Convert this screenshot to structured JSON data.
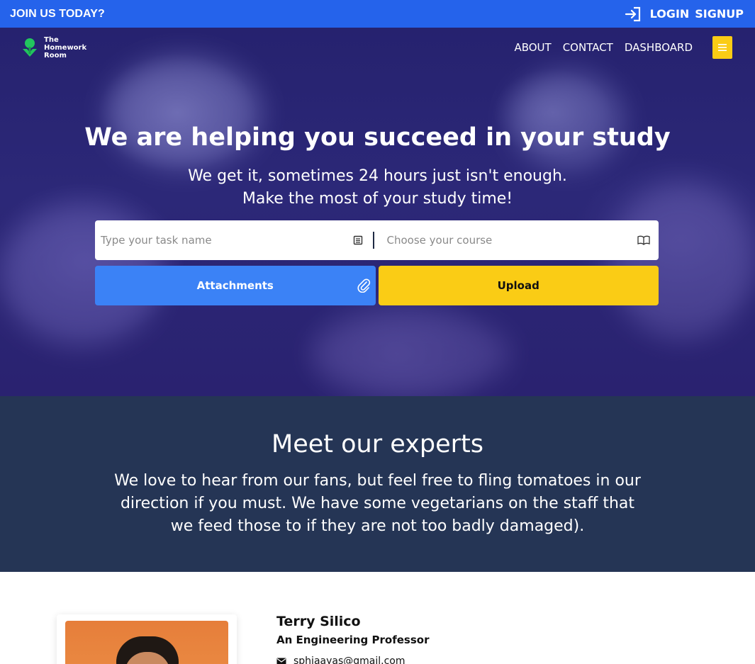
{
  "topbar": {
    "join_text": "JOIN US TODAY?",
    "login_label": "LOGIN",
    "signup_label": "SIGNUP",
    "background": "#2563eb"
  },
  "brand": {
    "logo_lines": [
      "The",
      "Homework",
      "Room"
    ],
    "logo_icon": "graduation-tree-icon",
    "logo_color": "#22c55e"
  },
  "nav": {
    "links": [
      "ABOUT",
      "CONTACT",
      "DASHBOARD"
    ],
    "menu_icon": "hamburger-icon",
    "menu_color": "#facc15"
  },
  "hero": {
    "title": "We are helping you succeed in your study",
    "subtitle_line1": "We get it, sometimes 24 hours just isn't enough.",
    "subtitle_line2": "Make the most of your study time!",
    "task_placeholder": "Type your task name",
    "course_placeholder": "Choose your course",
    "task_icon": "clipboard-icon",
    "course_icon": "book-icon",
    "attachments_label": "Attachments",
    "attachments_icon": "paperclip-icon",
    "upload_label": "Upload",
    "attachments_color": "#3b82f6",
    "upload_color": "#facc15"
  },
  "experts": {
    "title": "Meet our experts",
    "description": "We love to hear from our fans, but feel free to fling tomatoes in our direction if you must. We have some vegetarians on the staff that we feed those to if they are not too badly damaged).",
    "background": "#253555"
  },
  "expert_card": {
    "name": "Terry Silico",
    "role": "An Engineering Professor",
    "email": "sphiaayas@gmail.com",
    "email_icon": "envelope-icon"
  }
}
